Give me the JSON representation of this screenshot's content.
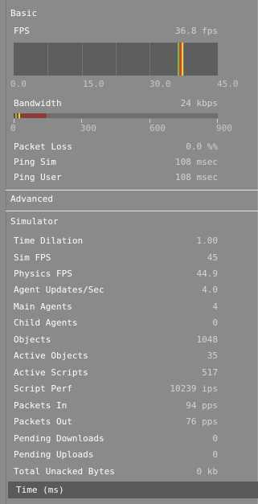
{
  "basic": {
    "header": "Basic",
    "fps": {
      "label": "FPS",
      "value": "36.8 fps",
      "ticks": [
        "0.0",
        "15.0",
        "30.0",
        "45.0"
      ],
      "current_fraction": 0.818
    },
    "bandwidth": {
      "label": "Bandwidth",
      "value": "24 kbps",
      "ticks": [
        "0",
        "300",
        "600",
        "900"
      ],
      "fill_fraction": 0.16
    },
    "rows": [
      {
        "label": "Packet Loss",
        "value": "0.0 %%"
      },
      {
        "label": "Ping Sim",
        "value": "108 msec"
      },
      {
        "label": "Ping User",
        "value": "108 msec"
      }
    ]
  },
  "advanced": {
    "header": "Advanced"
  },
  "simulator": {
    "header": "Simulator",
    "rows": [
      {
        "label": "Time Dilation",
        "value": "1.00"
      },
      {
        "label": "Sim FPS",
        "value": "45"
      },
      {
        "label": "Physics FPS",
        "value": "44.9"
      },
      {
        "label": "Agent Updates/Sec",
        "value": "4.0"
      },
      {
        "label": "Main Agents",
        "value": "4"
      },
      {
        "label": "Child Agents",
        "value": "0"
      },
      {
        "label": "Objects",
        "value": "1048"
      },
      {
        "label": "Active Objects",
        "value": "35"
      },
      {
        "label": "Active Scripts",
        "value": "517"
      },
      {
        "label": "Script Perf",
        "value": "10239 ips"
      },
      {
        "label": "Packets In",
        "value": "94 pps"
      },
      {
        "label": "Packets Out",
        "value": "76 pps"
      },
      {
        "label": "Pending Downloads",
        "value": "0"
      },
      {
        "label": "Pending Uploads",
        "value": "0"
      },
      {
        "label": "Total Unacked Bytes",
        "value": "0 kb"
      }
    ]
  },
  "time": {
    "header": "Time (ms)"
  },
  "colors": {
    "fps_red": "#e23b2e",
    "fps_green": "#4fd14a",
    "fps_yellow": "#e8d23a",
    "bandwidth_fill": "#8c3b3b"
  }
}
